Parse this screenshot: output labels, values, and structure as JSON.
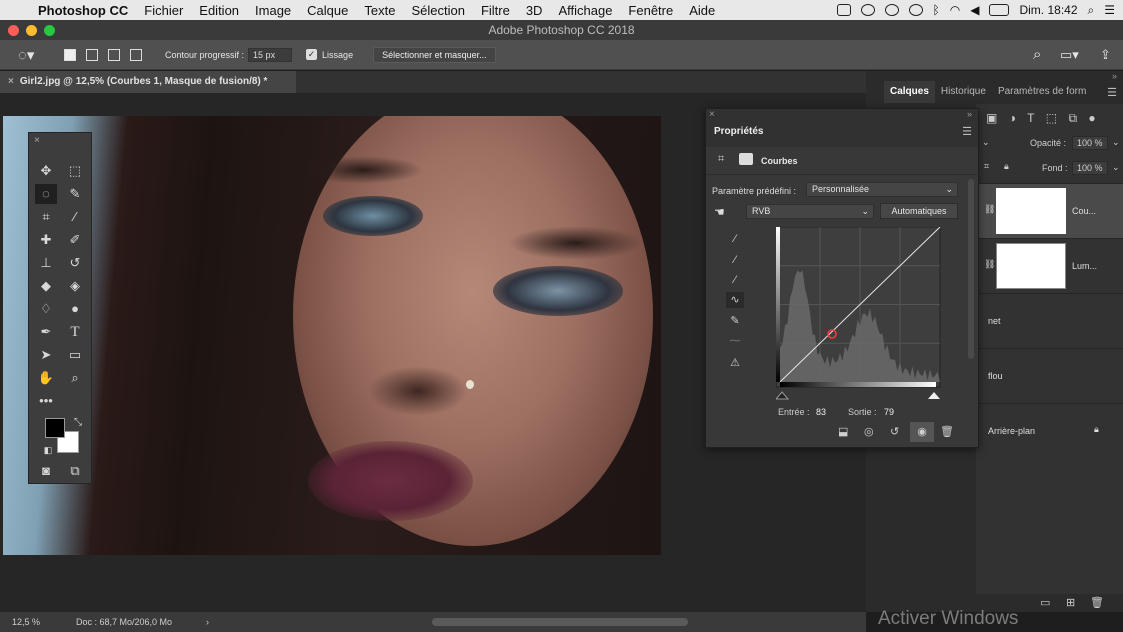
{
  "menubar": {
    "app": "Photoshop CC",
    "items": [
      "Fichier",
      "Edition",
      "Image",
      "Calque",
      "Texte",
      "Sélection",
      "Filtre",
      "3D",
      "Affichage",
      "Fenêtre",
      "Aide"
    ],
    "clock": "Dim. 18:42"
  },
  "window_title": "Adobe Photoshop CC 2018",
  "options": {
    "feather_label": "Contour progressif :",
    "feather_value": "15 px",
    "antialias_label": "Lissage",
    "select_mask_label": "Sélectionner et masquer..."
  },
  "document_tab": "Girl2.jpg @ 12,5% (Courbes 1, Masque de fusion/8) *",
  "status": {
    "zoom": "12,5 %",
    "doc": "Doc : 68,7 Mo/206,0 Mo",
    "arrow": "›"
  },
  "panel_tabs": [
    "Calques",
    "Historique",
    "Paramètres de form"
  ],
  "layers_panel": {
    "opacity_label": "Opacité :",
    "opacity_value": "100 %",
    "fill_label": "Fond :",
    "fill_value": "100 %",
    "layers": [
      {
        "name": "Cou...",
        "selected": true
      },
      {
        "name": "Lum..."
      },
      {
        "name": "net"
      },
      {
        "name": "flou"
      },
      {
        "name": "Arrière-plan",
        "locked": true
      }
    ]
  },
  "properties": {
    "title": "Propriétés",
    "adjustment": "Courbes",
    "preset_label": "Paramètre prédéfini :",
    "preset_value": "Personnalisée",
    "channel": "RVB",
    "auto_label": "Automatiques",
    "input_label": "Entrée :",
    "input_value": "83",
    "output_label": "Sortie :",
    "output_value": "79"
  },
  "watermark": "Activer Windows"
}
